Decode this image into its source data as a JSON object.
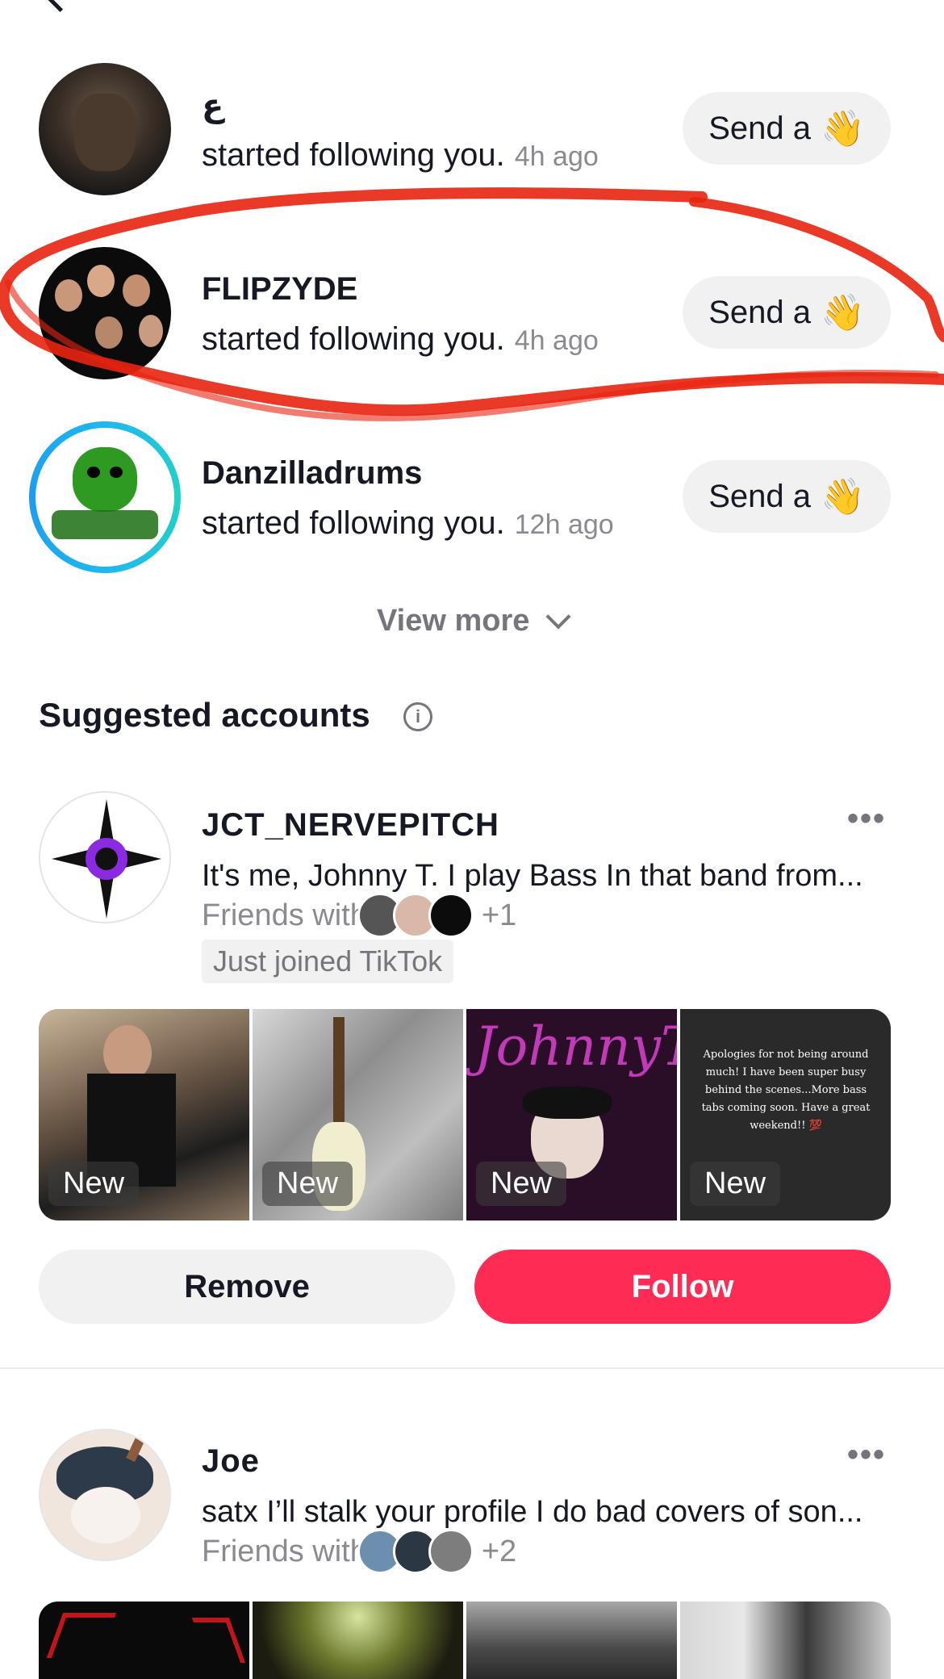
{
  "notifications": [
    {
      "username": "ع",
      "activity": "started following you.",
      "time": "4h ago",
      "button_label": "Send a",
      "button_icon": "wave-emoji"
    },
    {
      "username": "FLIPZYDE",
      "activity": "started following you.",
      "time": "4h ago",
      "button_label": "Send a",
      "button_icon": "wave-emoji"
    },
    {
      "username": "Danzilladrums",
      "activity": "started following you.",
      "time": "12h ago",
      "button_label": "Send a",
      "button_icon": "wave-emoji"
    }
  ],
  "wave_glyph": "👋",
  "view_more_label": "View more",
  "suggested": {
    "title": "Suggested accounts",
    "info_glyph": "i",
    "accounts": [
      {
        "username": "JCT_NERVEPITCH",
        "bio": "It's me, Johnny T. I play Bass  In that band from...",
        "friends_label": "Friends with",
        "friends_extra": "+1",
        "badge": "Just joined TikTok",
        "more_glyph": "•••",
        "thumb_label": "New",
        "thumb4_text": "Apologies for not being around much! I have been super busy behind the scenes...More bass tabs coming soon. Have a great weekend!! 💯",
        "thumb3_text": "JohnnyT"
      },
      {
        "username": "Joe",
        "bio": "satx I’ll stalk your profile I do bad covers of son...",
        "friends_label": "Friends with",
        "friends_extra": "+2",
        "more_glyph": "•••"
      }
    ]
  },
  "buttons": {
    "remove": "Remove",
    "follow": "Follow"
  },
  "colors": {
    "accent": "#fe2c55",
    "annotation": "#e8230f"
  }
}
